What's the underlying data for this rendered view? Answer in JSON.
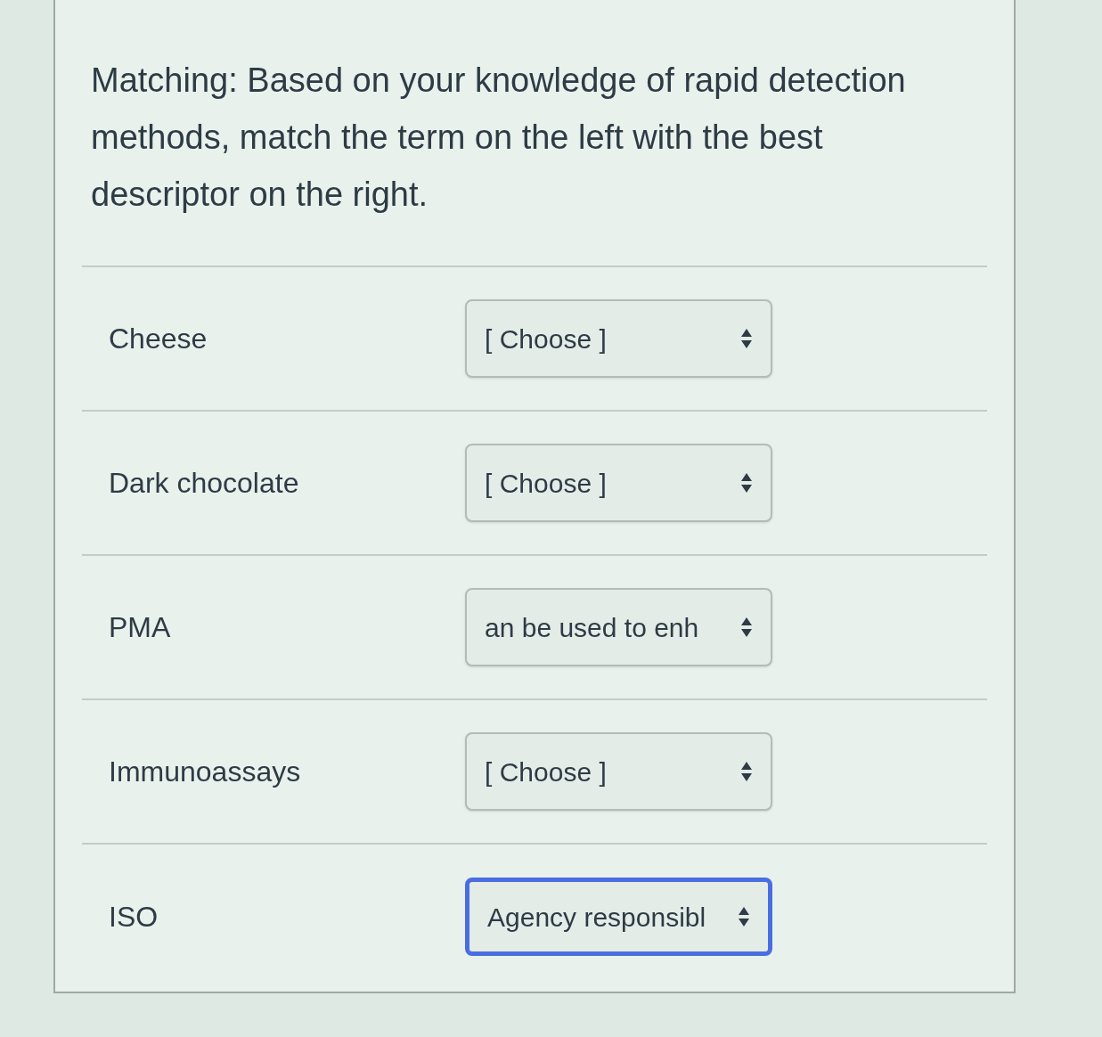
{
  "question": "Matching: Based on your knowledge of rapid detection methods, match the term on the left with the best descriptor on the right.",
  "rows": [
    {
      "term": "Cheese",
      "value": "[ Choose ]",
      "focused": false
    },
    {
      "term": "Dark chocolate",
      "value": "[ Choose ]",
      "focused": false
    },
    {
      "term": "PMA",
      "value": "an be used to enh",
      "focused": false
    },
    {
      "term": "Immunoassays",
      "value": "[ Choose ]",
      "focused": false
    },
    {
      "term": "ISO",
      "value": "Agency responsibl",
      "focused": true
    }
  ]
}
